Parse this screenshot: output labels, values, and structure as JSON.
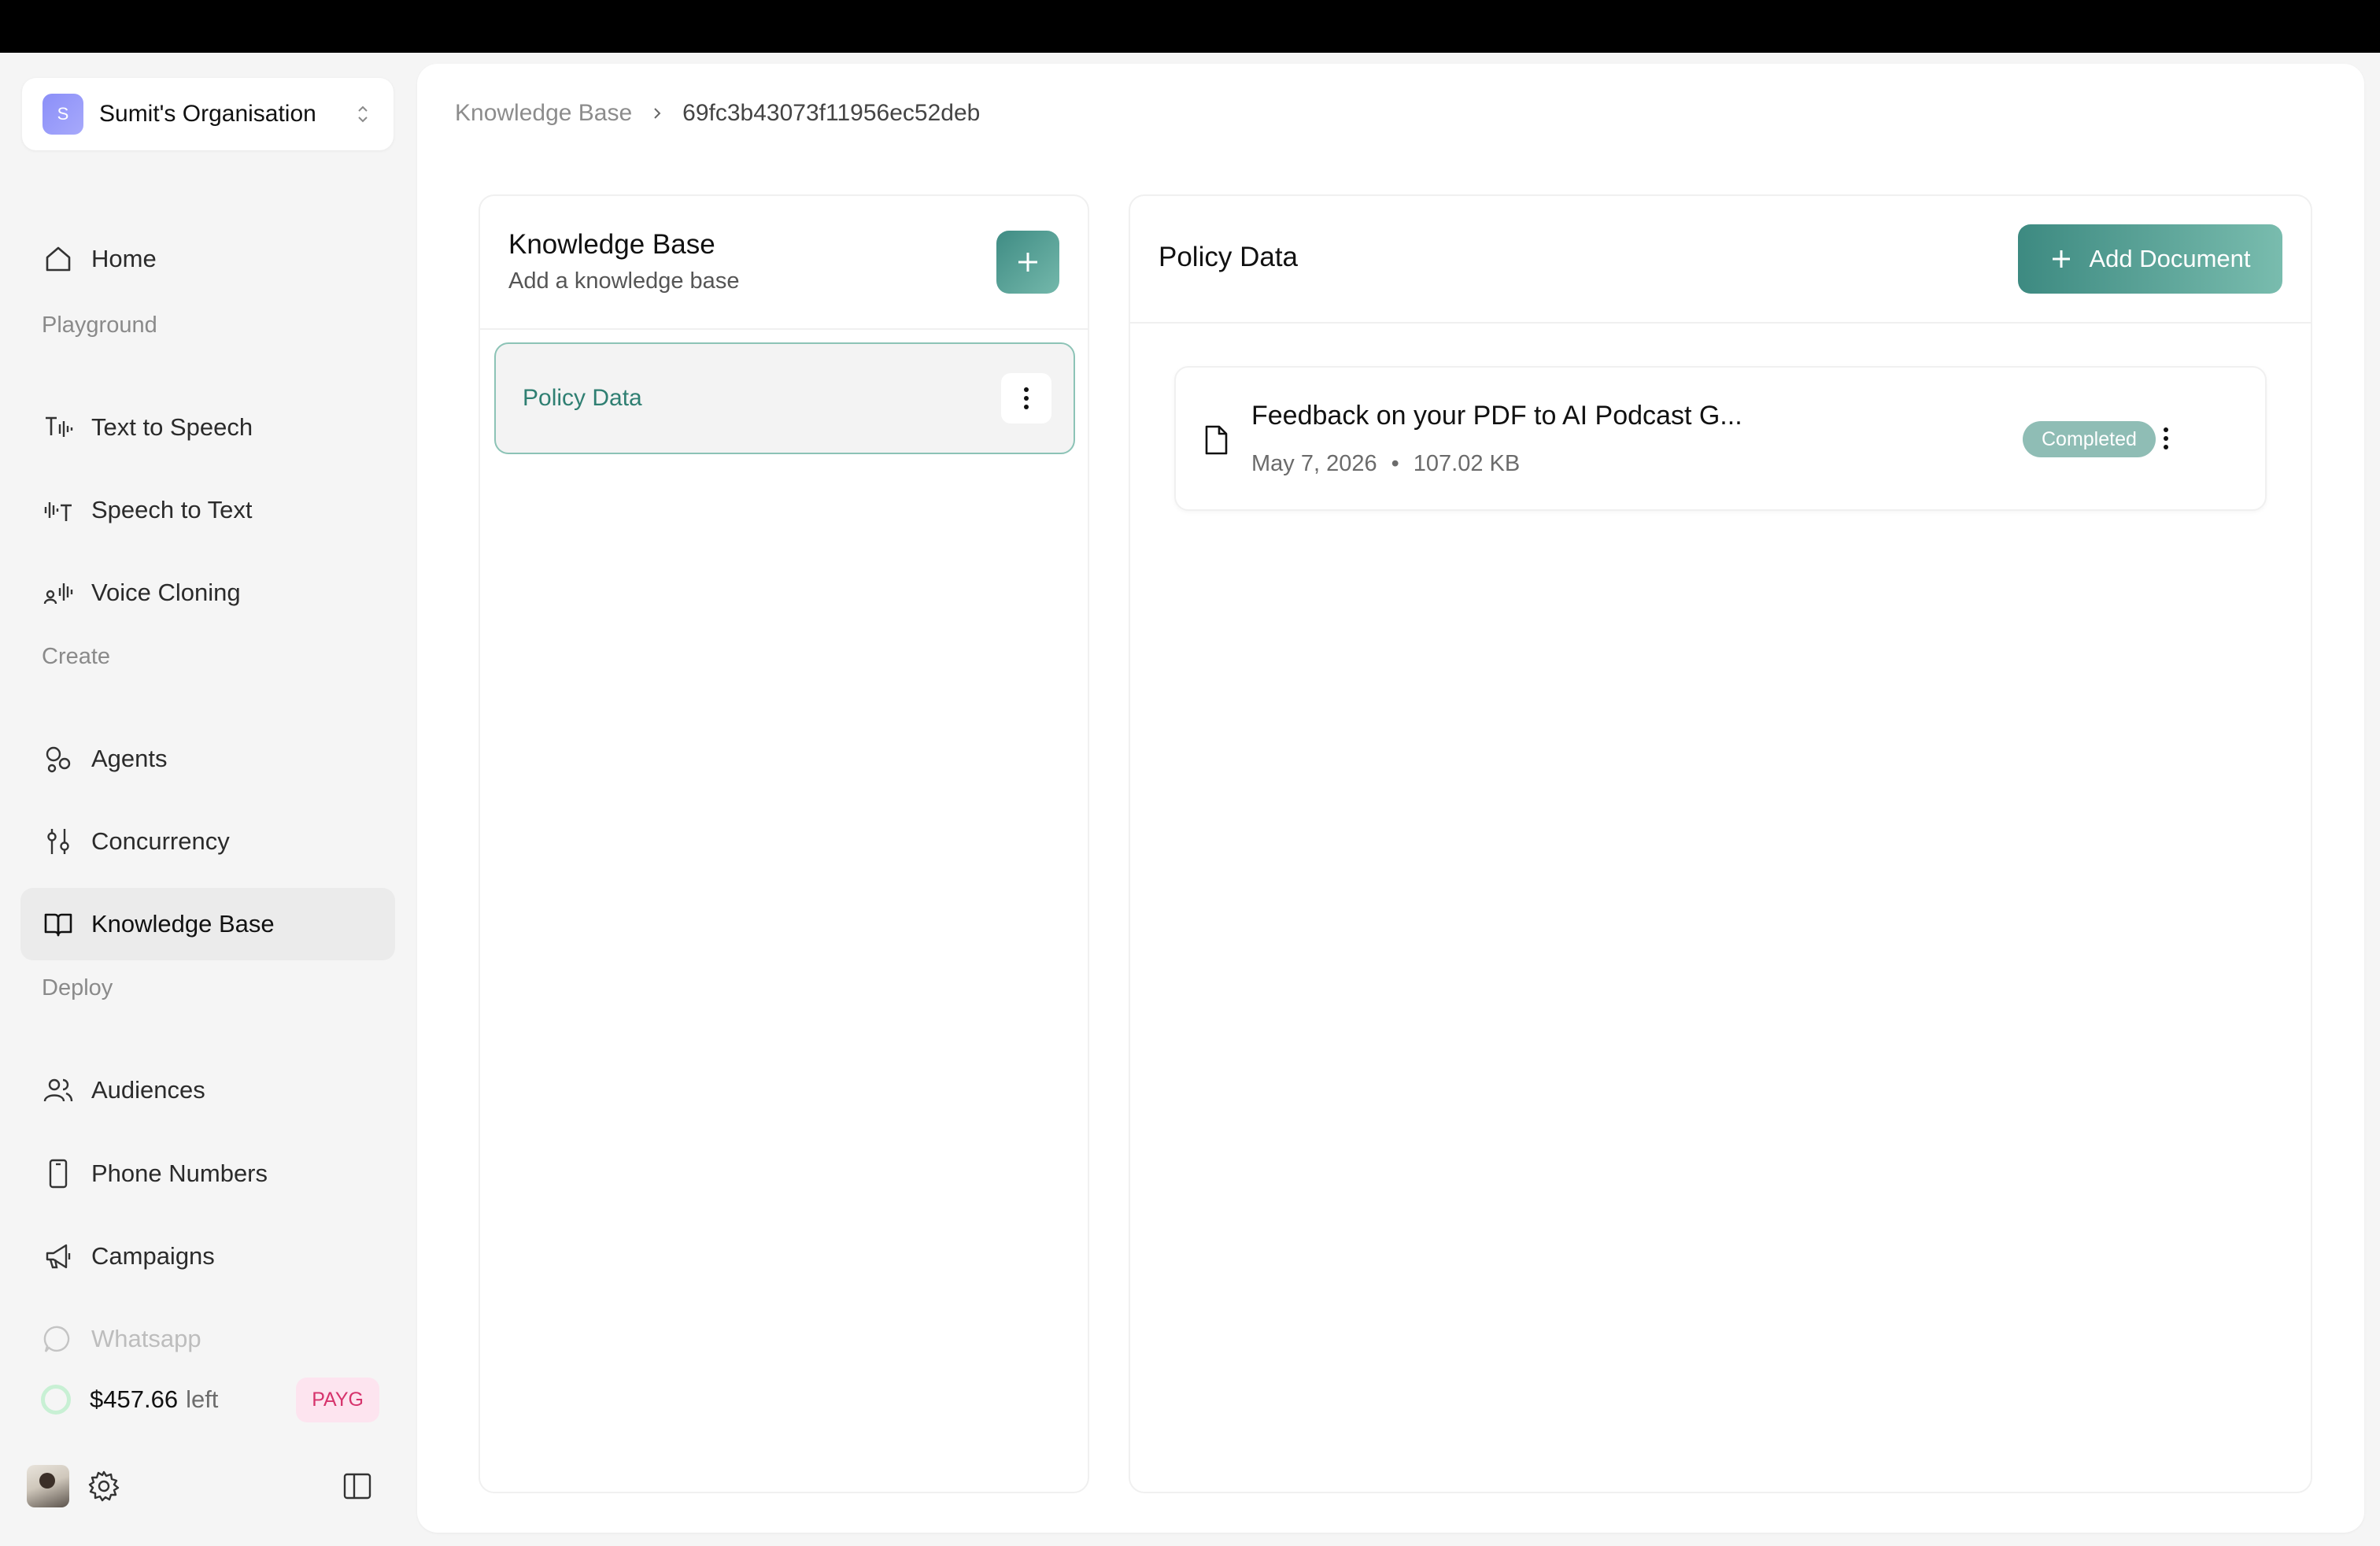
{
  "org": {
    "initial": "S",
    "name": "Sumit's Organisation"
  },
  "nav": {
    "home": "Home",
    "playground_label": "Playground",
    "text_to_speech": "Text to Speech",
    "speech_to_text": "Speech to Text",
    "voice_cloning": "Voice Cloning",
    "create_label": "Create",
    "agents": "Agents",
    "concurrency": "Concurrency",
    "knowledge_base": "Knowledge Base",
    "deploy_label": "Deploy",
    "audiences": "Audiences",
    "phone_numbers": "Phone Numbers",
    "campaigns": "Campaigns",
    "whatsapp": "Whatsapp",
    "active_item": "Knowledge Base"
  },
  "credits": {
    "amount": "$457.66",
    "suffix": "left",
    "plan": "PAYG"
  },
  "breadcrumb": {
    "root": "Knowledge Base",
    "current": "69fc3b43073f11956ec52deb"
  },
  "kb_panel": {
    "title": "Knowledge Base",
    "subtitle": "Add a knowledge base",
    "items": [
      {
        "label": "Policy Data",
        "selected": true
      }
    ]
  },
  "doc_panel": {
    "title": "Policy Data",
    "add_button": "Add Document",
    "documents": [
      {
        "name": "Feedback on your PDF to AI Podcast G...",
        "date": "May 7, 2026",
        "size": "107.02 KB",
        "status": "Completed"
      }
    ]
  },
  "colors": {
    "accent": "#3f8c84",
    "status_completed": "#8fbdb5",
    "payg_bg": "#fde4ef",
    "payg_text": "#d6336c"
  }
}
